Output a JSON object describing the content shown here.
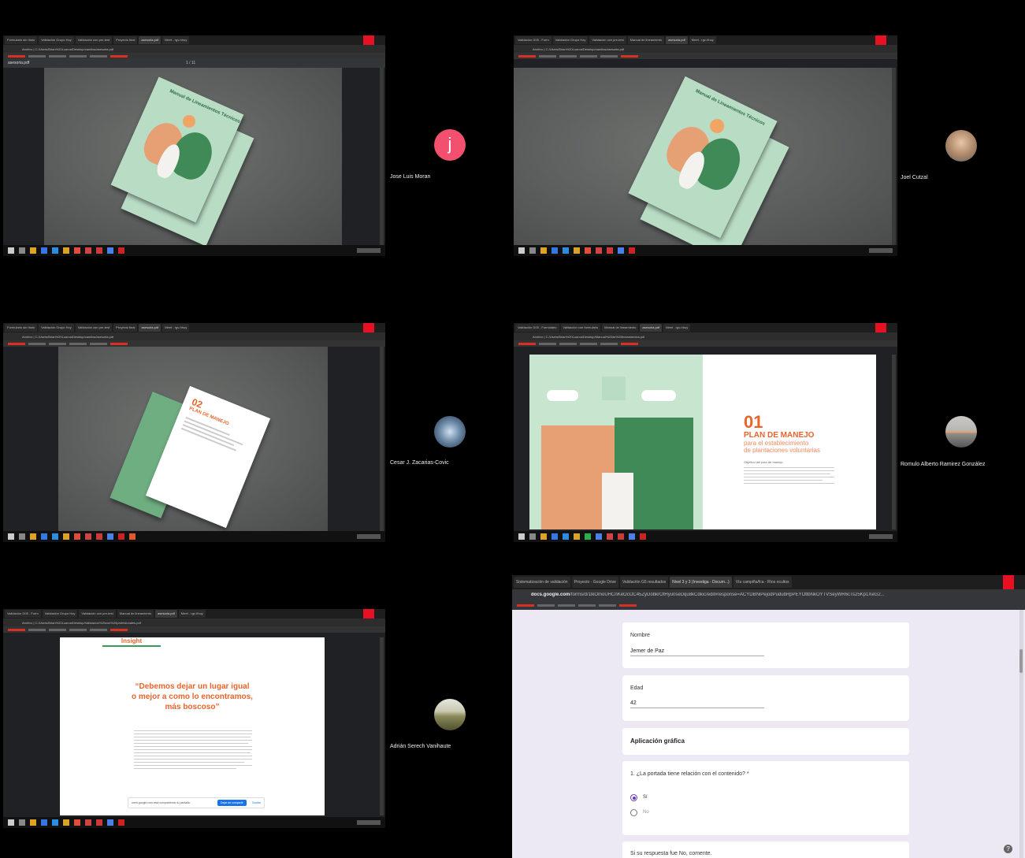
{
  "participants": [
    {
      "name": "Jose Luis Moran",
      "initial": "j"
    },
    {
      "name": "Joel Cutzal"
    },
    {
      "name": "Cesar J. Zacarias-Covic"
    },
    {
      "name": "Romulo Alberto Ramirez González"
    },
    {
      "name": "Adrián Serech Vanihaute"
    }
  ],
  "shares": {
    "s1": {
      "pdf_name": "asesoria.pdf",
      "page": "1 / 11",
      "book_title": "Manual de Lineamientos Técnicos"
    },
    "s2": {
      "book_title": "Manual de Lineamientos Técnicos"
    },
    "s3": {
      "number": "02",
      "heading": "PLAN DE MANEJO"
    },
    "s4": {
      "number": "01",
      "heading": "PLAN DE MANEJO",
      "sub1": "para el establecimiento",
      "sub2": "de plantaciones voluntarias",
      "section": "Objetivo del plan de manejo"
    },
    "s5": {
      "header": "Insight",
      "quote1": "“Debemos dejar un lugar igual",
      "quote2": "o mejor a como lo encontramos,",
      "quote3": "más boscoso”",
      "notice": "meet.google.com está compartiendo tu pantalla.",
      "stop_label": "Dejar de compartir",
      "hide_label": "Ocultar"
    }
  },
  "form": {
    "url": "docs.google.com",
    "q1": {
      "label": "Nombre",
      "value": "Jemer de Paz"
    },
    "q2": {
      "label": "Edad",
      "value": "42"
    },
    "section": "Aplicación gráfica",
    "q3": {
      "label": "1. ¿La portada tiene relación con el contenido? *",
      "options": [
        "Sí",
        "No"
      ],
      "selected": "Sí"
    },
    "q4": {
      "label": "Si su respuesta fue No, comente."
    },
    "help_icon": "?"
  },
  "colors": {
    "accent_orange": "#e8642c",
    "forms_purple": "#673ab7",
    "avatar_pink": "#f2506e",
    "book_green": "#b9dcc5"
  }
}
